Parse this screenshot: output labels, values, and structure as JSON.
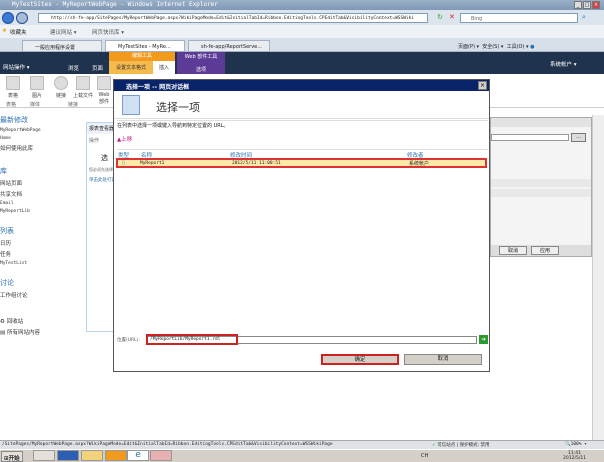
{
  "window": {
    "title": "MyTestSites - MyReportWebPage - Windows Internet Explorer",
    "min": "_",
    "max": "□",
    "close": "×"
  },
  "browser": {
    "address": "http://sh-fe-app/SitePages/MyReportWebPage.aspx?WikiPageMode=Edit&InitialTabId=Ribbon.EditingTools.CPEditTab&VisibilityContext=WSSWiki",
    "search_placeholder": "Bing",
    "favorites": {
      "label": "收藏夹",
      "items": [
        "建议网站 ▾",
        "网页快讯库 ▾"
      ]
    },
    "tabs": [
      "一般应用程序设置",
      "MyTestSites - MyRe...",
      "sh-fe-app/ReportServe..."
    ],
    "tools": [
      "页面(P) ▾",
      "安全(S) ▾",
      "工具(O) ▾"
    ]
  },
  "ribbon": {
    "site_actions": "网站操作 ▾",
    "tabs": [
      "浏览",
      "页面"
    ],
    "editing_tools": "编辑工具",
    "format_text": "设置文本格式",
    "insert": "插入",
    "webpart_tools": "Web 部件工具",
    "options": "选项",
    "user": "系统帐户 ▾",
    "buttons": [
      "表格",
      "图片",
      "链接",
      "上载文件",
      "Web 部件"
    ],
    "groups": [
      "表格",
      "媒体",
      "链接"
    ]
  },
  "leftnav": {
    "recent": "最新修改",
    "recent_items": [
      "MyReportWebPage",
      "Home",
      "如何使用此库"
    ],
    "libraries": "库",
    "library_items": [
      "网站页面",
      "共享文档",
      "Email",
      "MyReportLib"
    ],
    "lists": "列表",
    "list_items": [
      "日历",
      "任务",
      "MyTestList"
    ],
    "discussions": "讨论",
    "discussion_items": [
      "工作组讨论"
    ],
    "recycle": "回收站",
    "all_content": "所有网站内容"
  },
  "webpart": {
    "title": "报表查看器",
    "actions": "操作",
    "select": "选",
    "desc": "您必须先选择…",
    "link": "单击此处打开…"
  },
  "rightpanel": {
    "cancel": "取消",
    "apply": "应用"
  },
  "dialog": {
    "title": "选择一项 -- 网页对话框",
    "heading": "选择一项",
    "instruction": "在列表中选择一项或键入导航到特定位置的 URL。",
    "up": "上移",
    "columns": [
      "类型",
      "名称",
      "修改时间",
      "修改者"
    ],
    "rows": [
      {
        "name": "MyReport1",
        "modified": "2012/5/11 11:00:51",
        "modified_by": "系统帐户"
      }
    ],
    "location_label": "位置(URL):",
    "location_value": "/MyReportLib/MyReport1.rdl",
    "ok": "确定",
    "cancel": "取消"
  },
  "status": {
    "url": "/SitePages/MyReportWebPage.aspx?WikiPageMode=Edit&InitialTabId=Ribbon.EditingTools.CPEditTab&VisibilityContext=WSSWikiPage",
    "zone": "可信站点 | 保护模式: 禁用",
    "zoom": "100%"
  },
  "taskbar": {
    "start": "开始",
    "lang": "CH",
    "time": "11:41",
    "date": "2012/5/11"
  }
}
